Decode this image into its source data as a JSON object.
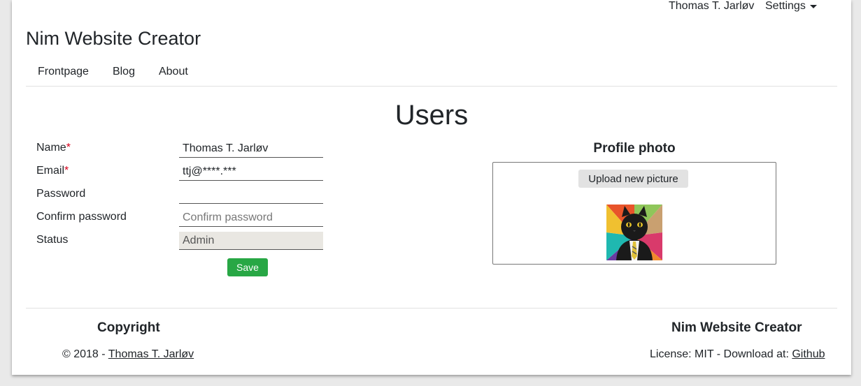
{
  "topbar": {
    "user": "Thomas T. Jarløv",
    "settings_label": "Settings"
  },
  "header": {
    "title": "Nim Website Creator",
    "nav": [
      "Frontpage",
      "Blog",
      "About"
    ]
  },
  "main": {
    "heading": "Users",
    "form": {
      "name_label": "Name",
      "email_label": "Email",
      "password_label": "Password",
      "confirm_label": "Confirm password",
      "status_label": "Status",
      "required_marker": "*",
      "name_value": "Thomas T. Jarløv",
      "email_value": "ttj@****.***",
      "password_value": "",
      "confirm_placeholder": "Confirm password",
      "status_value": "Admin",
      "save_label": "Save"
    },
    "profile": {
      "title": "Profile photo",
      "upload_label": "Upload new picture"
    }
  },
  "footer": {
    "copyright_heading": "Copyright",
    "copyright_prefix": "© 2018 - ",
    "copyright_link": "Thomas T. Jarløv",
    "site_heading": "Nim Website Creator",
    "license_prefix": "License: MIT - Download at: ",
    "license_link": "Github"
  },
  "colors": {
    "save_green": "#28a745",
    "required_red": "#d9001b"
  },
  "icons": {
    "settings_caret": "caret-down-icon"
  }
}
